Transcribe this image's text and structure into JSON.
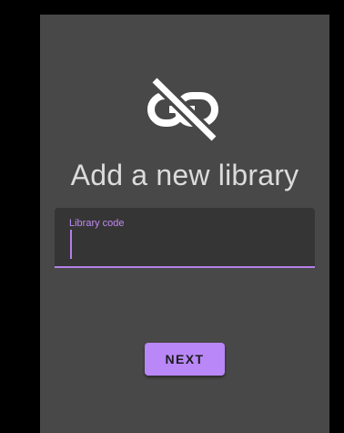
{
  "dialog": {
    "icon": "link-off-icon",
    "title": "Add a new library",
    "field": {
      "label": "Library code",
      "value": "",
      "focused": true
    },
    "next_label": "NEXT"
  },
  "colors": {
    "backdrop": "#000000",
    "panel": "#484848",
    "field_background": "#353535",
    "accent": "#b987f8",
    "title_text": "#dcdcdc",
    "button_text": "#1c1c1c"
  }
}
